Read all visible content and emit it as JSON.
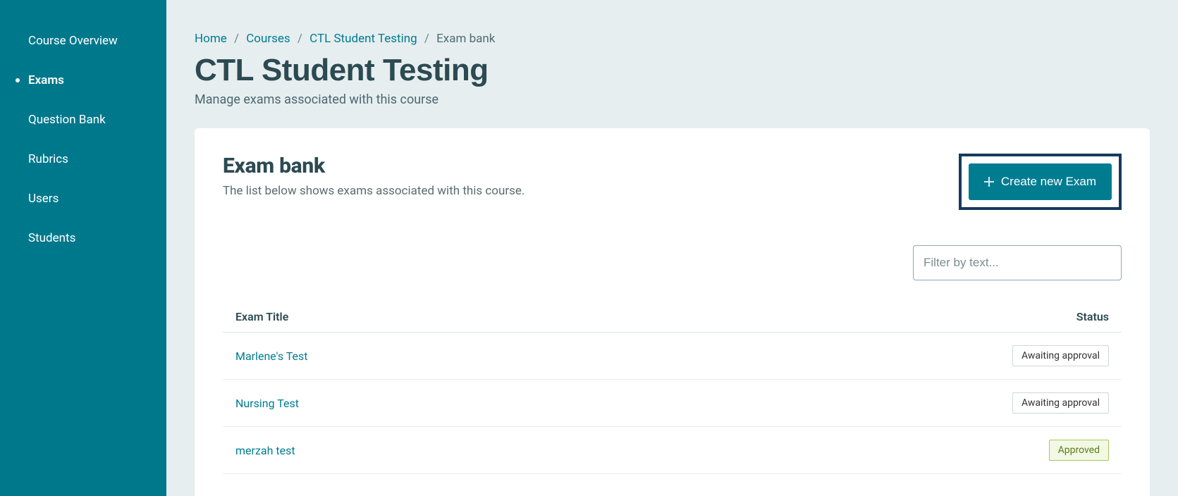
{
  "sidebar": {
    "items": [
      {
        "label": "Course Overview",
        "active": false
      },
      {
        "label": "Exams",
        "active": true
      },
      {
        "label": "Question Bank",
        "active": false
      },
      {
        "label": "Rubrics",
        "active": false
      },
      {
        "label": "Users",
        "active": false
      },
      {
        "label": "Students",
        "active": false
      }
    ]
  },
  "breadcrumb": {
    "items": [
      {
        "label": "Home",
        "link": true
      },
      {
        "label": "Courses",
        "link": true
      },
      {
        "label": "CTL Student Testing",
        "link": true
      },
      {
        "label": "Exam bank",
        "link": false
      }
    ]
  },
  "page": {
    "title": "CTL Student Testing",
    "subtitle": "Manage exams associated with this course"
  },
  "card": {
    "title": "Exam bank",
    "subtitle": "The list below shows exams associated with this course.",
    "create_label": "Create new Exam"
  },
  "filter": {
    "placeholder": "Filter by text..."
  },
  "table": {
    "columns": {
      "title": "Exam Title",
      "status": "Status"
    },
    "rows": [
      {
        "title": "Marlene's Test",
        "status": "Awaiting approval",
        "approved": false
      },
      {
        "title": "Nursing Test",
        "status": "Awaiting approval",
        "approved": false
      },
      {
        "title": "merzah test",
        "status": "Approved",
        "approved": true
      }
    ]
  }
}
